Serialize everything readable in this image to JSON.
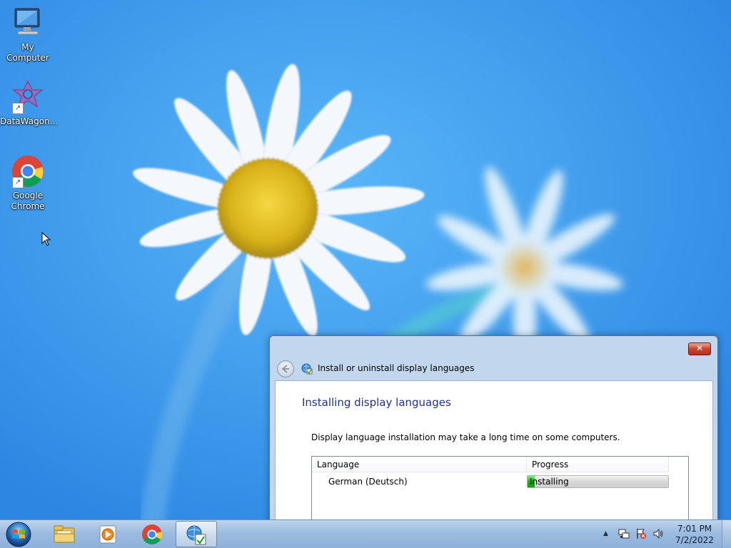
{
  "desktop": {
    "icons": [
      {
        "label": "My Computer",
        "icon": "computer-icon"
      },
      {
        "label": "DataWagon...",
        "icon": "datawagon-icon"
      },
      {
        "label": "Google Chrome",
        "icon": "chrome-icon"
      }
    ]
  },
  "dialog": {
    "nav_title": "Install or uninstall display languages",
    "heading": "Installing display languages",
    "description": "Display language installation may take a long time on some computers.",
    "close_label": "✕",
    "table": {
      "columns": [
        "Language",
        "Progress"
      ],
      "rows": [
        {
          "language": "German (Deutsch)",
          "progress_text": "Installing",
          "progress_fraction": 0.05
        }
      ]
    }
  },
  "taskbar": {
    "pinned": [
      {
        "name": "windows-explorer",
        "icon": "folder-icon"
      },
      {
        "name": "media-player",
        "icon": "media-player-icon"
      },
      {
        "name": "google-chrome",
        "icon": "chrome-icon"
      },
      {
        "name": "language-installer",
        "icon": "language-installer-icon",
        "active": true
      }
    ],
    "clock": {
      "time": "7:01 PM",
      "date": "7/2/2022"
    }
  },
  "colors": {
    "desktop_blue": "#3d9cf0",
    "taskbar": "#9cbbe0",
    "progress_green": "#16b516",
    "heading_blue": "#1e3287",
    "close_red": "#c7452e"
  }
}
